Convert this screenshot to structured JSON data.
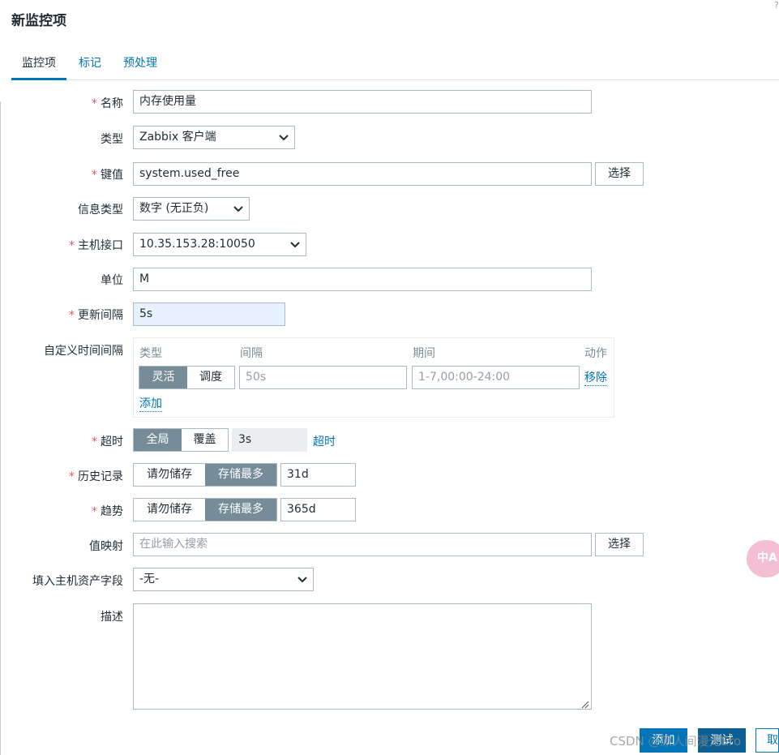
{
  "dialog": {
    "title": "新监控项",
    "help": "?"
  },
  "tabs": [
    {
      "label": "监控项"
    },
    {
      "label": "标记"
    },
    {
      "label": "预处理"
    }
  ],
  "form": {
    "name": {
      "label": "名称",
      "required": "*",
      "value": "内存使用量"
    },
    "type": {
      "label": "类型",
      "value": "Zabbix 客户端"
    },
    "key": {
      "label": "键值",
      "required": "*",
      "value": "system.used_free",
      "select_button": "选择"
    },
    "info_type": {
      "label": "信息类型",
      "value": "数字 (无正负)"
    },
    "interface": {
      "label": "主机接口",
      "required": "*",
      "value": "10.35.153.28:10050"
    },
    "units": {
      "label": "单位",
      "value": "M"
    },
    "update_interval": {
      "label": "更新间隔",
      "required": "*",
      "value": "5s"
    },
    "custom_intervals": {
      "label": "自定义时间间隔",
      "headers": {
        "type": "类型",
        "interval": "间隔",
        "period": "期间",
        "action": "动作"
      },
      "row": {
        "type_options": [
          "灵活",
          "调度"
        ],
        "type_selected": "灵活",
        "interval_placeholder": "50s",
        "period_placeholder": "1-7,00:00-24:00",
        "remove": "移除"
      },
      "add": "添加"
    },
    "timeout": {
      "label": "超时",
      "required": "*",
      "options": [
        "全局",
        "覆盖"
      ],
      "selected": "全局",
      "value": "3s",
      "link": "超时"
    },
    "history": {
      "label": "历史记录",
      "required": "*",
      "options": [
        "请勿储存",
        "存储最多"
      ],
      "selected": "存储最多",
      "value": "31d"
    },
    "trends": {
      "label": "趋势",
      "required": "*",
      "options": [
        "请勿储存",
        "存储最多"
      ],
      "selected": "存储最多",
      "value": "365d"
    },
    "valuemap": {
      "label": "值映射",
      "placeholder": "在此输入搜索",
      "select_button": "选择"
    },
    "inventory": {
      "label": "填入主机资产字段",
      "value": "-无-"
    },
    "description": {
      "label": "描述",
      "value": ""
    }
  },
  "footer": {
    "add": "添加",
    "test": "测试",
    "cancel": "取"
  },
  "watermark": "CSDN @原人间漫无Ero",
  "translate_fab": "中A",
  "colors": {
    "accent": "#0275b8",
    "required": "#e45959",
    "segment_active": "#768d99"
  }
}
